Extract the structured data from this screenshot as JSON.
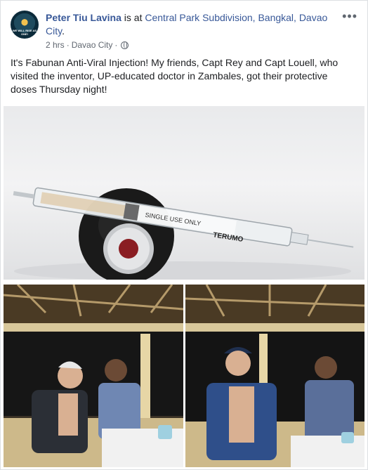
{
  "post": {
    "author": "Peter Tiu Lavina",
    "is_at": " is at ",
    "location": "Central Park Subdivision, Bangkal, Davao City",
    "period": ".",
    "time": "2 hrs",
    "separator": "·",
    "place": "Davao City",
    "more": "•••",
    "text": "It's Fabunan Anti-Viral Injection! My friends, Capt Rey and Capt Louell, who visited the inventor, UP-educated doctor in Zambales, got their protective doses Thursday night!",
    "avatar_text": "WE WILL RISE AS ONE!"
  },
  "photos": {
    "main_syringe_label": "SINGLE USE ONLY",
    "main_brand": "TERUMO"
  },
  "colors": {
    "link": "#385898",
    "muted": "#606770",
    "text": "#1c1e21"
  }
}
